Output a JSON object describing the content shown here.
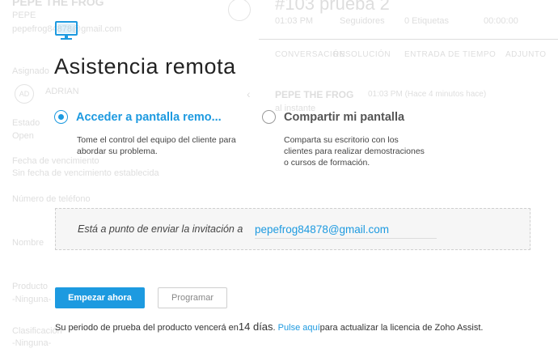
{
  "background": {
    "contact_name": "PEPE THE FROG",
    "contact_company": "PEPE",
    "contact_email": "pepefrog84878@gmail.com",
    "ticket_title": "#103  prueba 2",
    "ticket_meta": [
      "01:03 PM",
      "Seguidores",
      "0 Etiquetas",
      "00:00:00"
    ],
    "tabs": [
      "CONVERSACIÓN",
      "RESOLUCIÓN",
      "ENTRADA DE TIEMPO",
      "ADJUNTO"
    ],
    "agent_label": "Asignado",
    "agent_initials": "AD",
    "agent_name": "ADRIAN",
    "status_label": "Estado",
    "status_value": "Open",
    "due_label": "Fecha de vencimiento",
    "due_value": "Sin fecha de vencimiento establecida",
    "phone_label": "Número de teléfono",
    "name_label": "Nombre",
    "field1_label": "Producto",
    "field1_value": "-Ninguna-",
    "field2_label": "Clasificación",
    "field2_value": "-Ninguna-",
    "thread_name": "PEPE THE FROG",
    "thread_meta": "01:03 PM (Hace 4 minutos hace)",
    "thread_text": "al instante"
  },
  "modal": {
    "title": "Asistencia remota",
    "option1": {
      "label": "Acceder a pantalla remo...",
      "description": "Tome el control del equipo del cliente para abordar su problema.",
      "selected": true
    },
    "option2": {
      "label": "Compartir mi pantalla",
      "description": "Comparta su escritorio con los clientes para realizar demostraciones o cursos de formación.",
      "selected": false
    },
    "invite_text": "Está a punto de enviar la invitación a",
    "invite_email": "pepefrog84878@gmail.com",
    "start_button": "Empezar ahora",
    "schedule_button": "Programar",
    "trial_prefix": "Su periodo de prueba del producto vencerá en",
    "trial_days": "14 días",
    "trial_link": "Pulse aquí",
    "trial_suffix": "para actualizar la licencia de Zoho Assist."
  },
  "colors": {
    "accent": "#1d9ae0",
    "text": "#333333"
  },
  "icons": {
    "modal_icon": "monitor-icon",
    "bell": "bell-icon"
  }
}
